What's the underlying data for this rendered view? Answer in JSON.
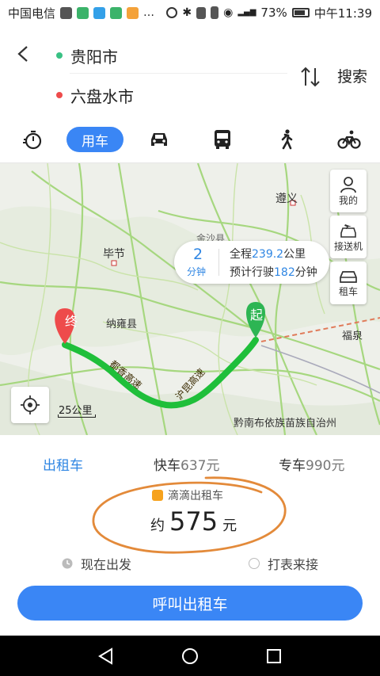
{
  "status_bar": {
    "carrier": "中国电信",
    "battery_percent": "73%",
    "time": "中午11:39"
  },
  "route": {
    "origin": "贵阳市",
    "destination": "六盘水市",
    "search_label": "搜索",
    "origin_color": "#39c184",
    "destination_color": "#ee4b4b"
  },
  "transport_tabs": [
    {
      "label": "",
      "icon": "stopwatch-icon"
    },
    {
      "label": "用车",
      "icon": "",
      "active": true
    },
    {
      "label": "",
      "icon": "car-icon"
    },
    {
      "label": "",
      "icon": "bus-icon"
    },
    {
      "label": "",
      "icon": "walk-icon"
    },
    {
      "label": "",
      "icon": "bike-icon"
    }
  ],
  "map": {
    "labels": {
      "zunyi": "遵义",
      "bijie": "毕节",
      "nayong": "纳雍县",
      "fuquan": "福泉",
      "qiannan": "黔南布依族苗族自治州",
      "jinsha": "金沙县",
      "highway1": "都香高速",
      "highway2": "沪昆高速"
    },
    "start_marker": "起",
    "end_marker": "终",
    "route_color": "#1fbf3a",
    "side_buttons": {
      "mine": "我的",
      "pickup": "接送机",
      "rental": "租车"
    },
    "info": {
      "duration_value": "2",
      "duration_unit": "分钟",
      "distance_prefix": "全程",
      "distance_value": "239.2",
      "distance_unit": "公里",
      "eta_prefix": "预计行驶",
      "eta_value": "182",
      "eta_unit": "分钟"
    },
    "scale": "25公里"
  },
  "ride_panel": {
    "tabs": {
      "taxi": "出租车",
      "express_label": "快车",
      "express_price": "637元",
      "premium_label": "专车",
      "premium_price": "990元"
    },
    "provider": "滴滴出租车",
    "price_prefix": "约",
    "price_value": "575",
    "price_unit": "元",
    "option_now": "现在出发",
    "option_meter": "打表来接",
    "cta": "呼叫出租车",
    "accent_color": "#3a86f5"
  }
}
